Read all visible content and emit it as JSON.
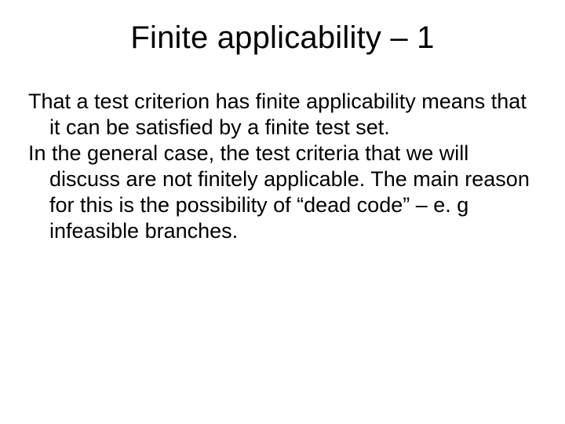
{
  "title": "Finite applicability – 1",
  "paragraph1": "That a test criterion has finite applicability means that it can be satisfied by a finite test set.",
  "paragraph2": "In the general case, the test criteria that we will discuss are not finitely applicable. The main reason for this is the possibility of “dead code” – e. g infeasible branches."
}
